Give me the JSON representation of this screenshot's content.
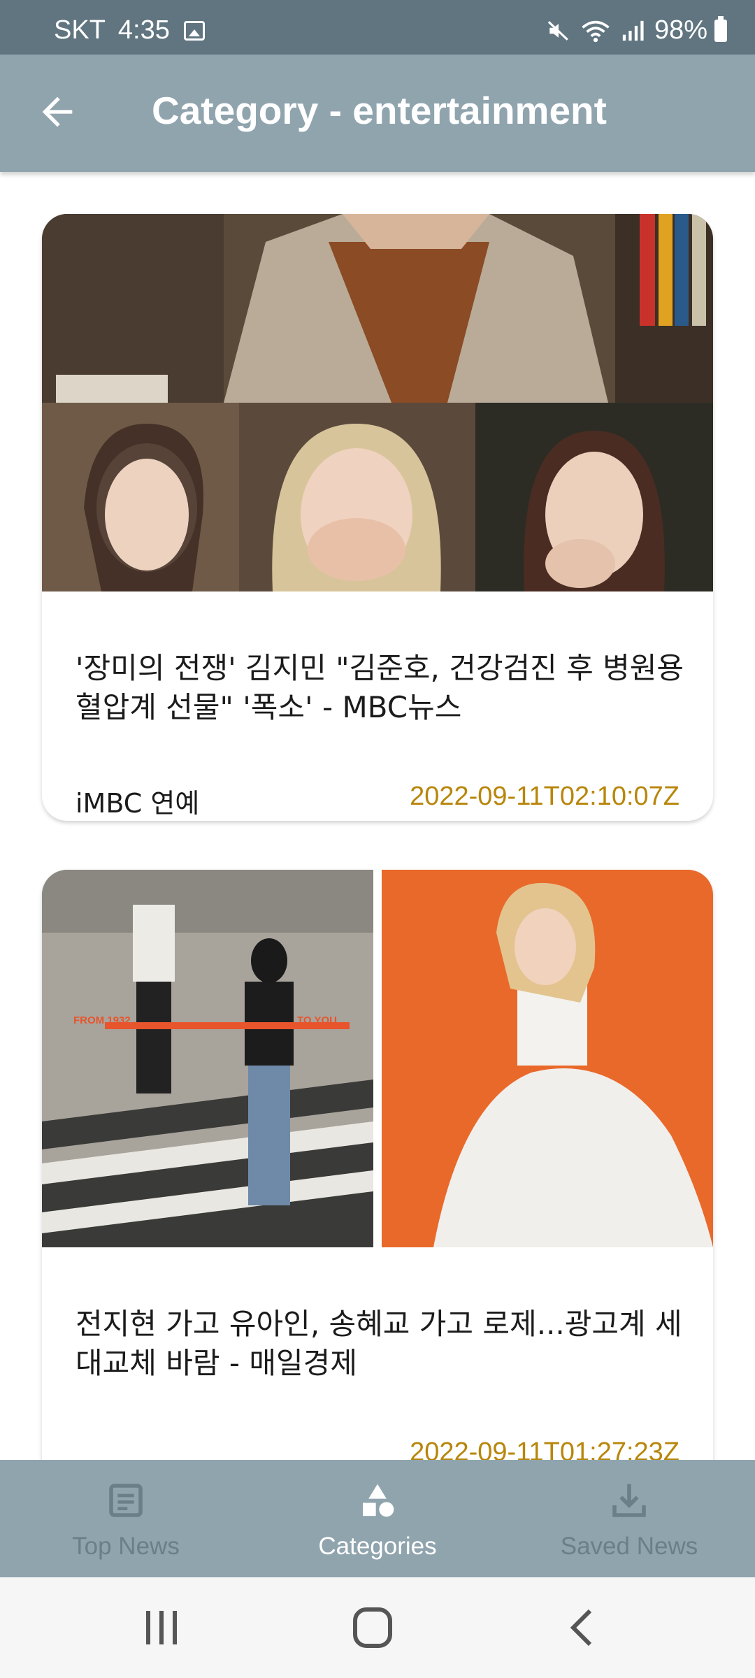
{
  "status_bar": {
    "carrier": "SKT",
    "time": "4:35",
    "battery": "98%"
  },
  "app_bar": {
    "title": "Category - entertainment"
  },
  "articles": [
    {
      "title": "'장미의 전쟁' 김지민 \"김준호, 건강검진 후 병원용 혈압계 선물\" '폭소' - MBC뉴스",
      "source": "iMBC 연예",
      "date": "2022-09-11T02:10:07Z"
    },
    {
      "title": "전지현 가고 유아인, 송혜교 가고 로제...광고계 세대교체 바람 - 매일경제",
      "source": "",
      "date": "2022-09-11T01:27:23Z",
      "image_text": {
        "left": "FROM 1932",
        "right": "TO YOU"
      }
    }
  ],
  "bottom_nav": {
    "items": [
      {
        "label": "Top News",
        "icon": "article-icon",
        "active": false
      },
      {
        "label": "Categories",
        "icon": "shapes-icon",
        "active": true
      },
      {
        "label": "Saved News",
        "icon": "download-icon",
        "active": false
      }
    ]
  },
  "colors": {
    "status_bar": "#607580",
    "app_bar": "#90a4ae",
    "date_text": "#b8860b",
    "nav_active": "#ffffff",
    "nav_inactive": "#6b7f89"
  }
}
